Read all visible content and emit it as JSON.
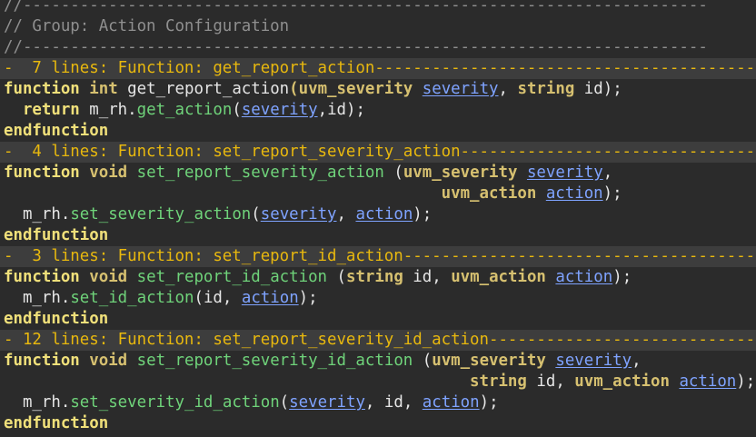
{
  "editor": {
    "comment_rule_top": "//------------------------------------------------------------------------",
    "comment_group": "// Group: Action Configuration",
    "comment_rule_bottom": "//------------------------------------------------------------------------",
    "folds": [
      "-  7 lines: Function: get_report_action----------------------------------------",
      "-  4 lines: Function: set_report_severity_action-------------------------------",
      "-  3 lines: Function: set_report_id_action---------------------------------------",
      "- 12 lines: Function: set_report_severity_id_action------------------------------"
    ],
    "kw": {
      "function": "function",
      "return": "return",
      "endfunction": "endfunction"
    },
    "types": {
      "int": "int",
      "void": "void",
      "uvm_severity": "uvm_severity",
      "string": "string",
      "uvm_action": "uvm_action"
    },
    "names": {
      "get_report_action": "get_report_action",
      "set_report_severity_action": "set_report_severity_action",
      "set_report_id_action": "set_report_id_action",
      "set_report_severity_id_action": "set_report_severity_id_action",
      "m_rh": "m_rh",
      "get_action": "get_action",
      "set_severity_action": "set_severity_action",
      "set_id_action": "set_id_action",
      "set_severity_id_action": "set_severity_id_action"
    },
    "idents": {
      "severity": "severity",
      "id": "id",
      "action": "action"
    }
  }
}
